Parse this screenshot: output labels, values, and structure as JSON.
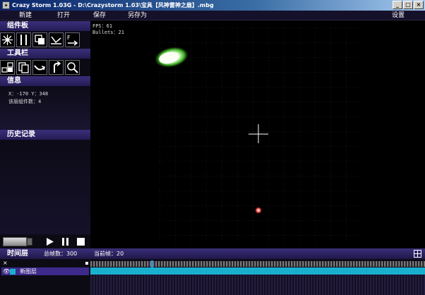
{
  "window": {
    "title": "Crazy Storm 1.03G - D:\\Crazystorm 1.03\\宝具【风神雷神之扇】.mbg",
    "icon": "app-icon"
  },
  "menu": {
    "new": "新建",
    "open": "打开",
    "save": "保存",
    "save_as": "另存为",
    "settings": "设置"
  },
  "panels": {
    "components": "组件板",
    "toolbar": "工具栏",
    "info": "信息",
    "history": "历史记录"
  },
  "info": {
    "coords": "X：-170  Y：348",
    "layer_count": "该层组件数：4"
  },
  "stats": {
    "fps": "FPS：61",
    "bullets": "Bullets：21"
  },
  "timeline": {
    "title": "时间层",
    "total_frames": "总帧数：300",
    "current_frame": "当前帧：20",
    "layer_name": "新图层",
    "layer_color": "#19b0d0"
  },
  "colors": {
    "accent": "#3a2f7a",
    "glow": "#66ff44",
    "bullet": "#ff4444"
  },
  "icons": [
    "burst-icon",
    "pillar-icon",
    "squares-icon",
    "bounce-icon",
    "force-icon",
    "layers-icon",
    "copy-icon",
    "curve-icon",
    "return-icon",
    "zoom-icon"
  ]
}
